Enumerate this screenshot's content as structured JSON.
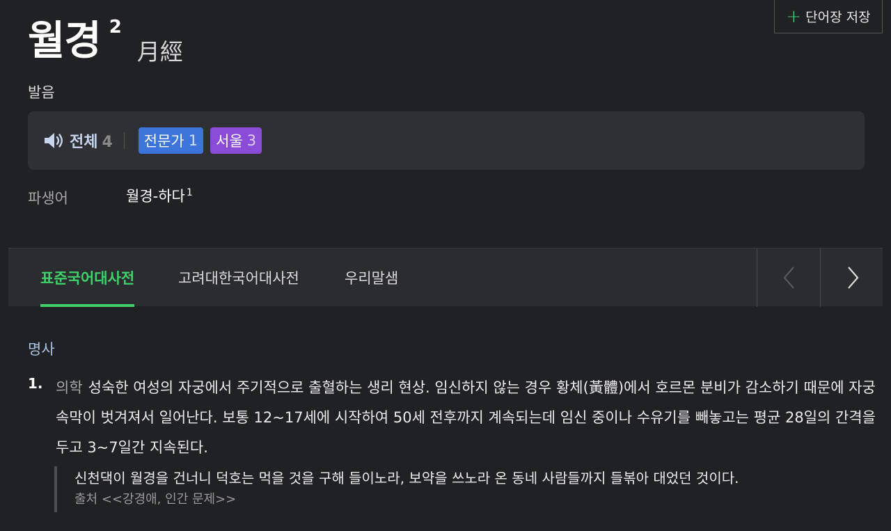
{
  "save_button": {
    "icon": "plus-icon",
    "label": "단어장 저장"
  },
  "headword": {
    "word": "월경",
    "homonym_number": "2",
    "hanja": "月經"
  },
  "pronunciation": {
    "label": "발음",
    "all_label": "전체",
    "all_count": "4",
    "badges": [
      {
        "label": "전문가",
        "count": "1",
        "color": "#3c74d9"
      },
      {
        "label": "서울",
        "count": "3",
        "color": "#8a4bd6"
      }
    ]
  },
  "derivative": {
    "label": "파생어",
    "word": "월경-하다",
    "sup": "1"
  },
  "tabs": [
    {
      "label": "표준국어대사전",
      "active": true
    },
    {
      "label": "고려대한국어대사전",
      "active": false
    },
    {
      "label": "우리말샘",
      "active": false
    }
  ],
  "definition": {
    "part_of_speech": "명사",
    "number": "1.",
    "field": "의학",
    "text": "성숙한 여성의 자궁에서 주기적으로 출혈하는 생리 현상. 임신하지 않는 경우 황체(黃體)에서 호르몬 분비가 감소하기 때문에 자궁 속막이 벗겨져서 일어난다. 보통 12~17세에 시작하여 50세 전후까지 계속되는데 임신 중이나 수유기를 빼놓고는 평균 28일의 간격을 두고 3~7일간 지속된다.",
    "example": {
      "text": "신천댁이 월경을 건너니 덕호는 먹을 것을 구해 들이노라, 보약을 쓰노라 온 동네 사람들까지 들볶아 대었던 것이다.",
      "source": "출처 <<강경애, 인간 문제>>"
    }
  },
  "colors": {
    "accent": "#3fd26a",
    "background": "#202124",
    "panel": "#2f3034"
  }
}
